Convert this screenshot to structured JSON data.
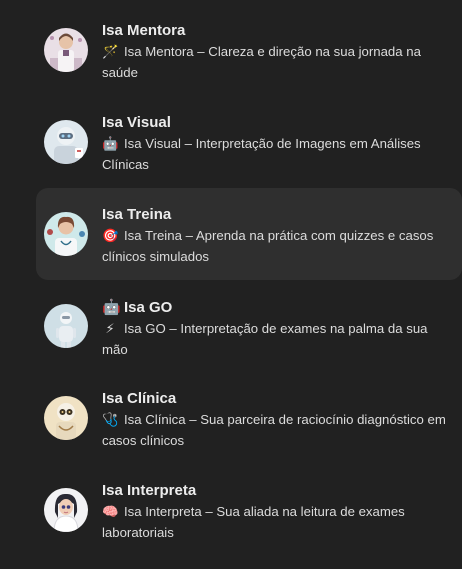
{
  "gpts": [
    {
      "name": "Isa Mentora",
      "emoji": "🪄",
      "description": "Isa Mentora – Clareza e direção na sua jornada na saúde",
      "avatar_icon": "mentora-doctor-avatar",
      "colors": {
        "bg": "#e9dfe6",
        "accent": "#7a5a7a"
      }
    },
    {
      "name": "Isa Visual",
      "emoji": "🤖",
      "description": "Isa Visual – Interpretação de Imagens em Análises Clínicas",
      "avatar_icon": "visual-robot-avatar",
      "colors": {
        "bg": "#dfe8ee",
        "accent": "#5c6e82"
      }
    },
    {
      "name": "Isa Treina",
      "emoji": "🎯",
      "description": "Isa Treina – Aprenda na prática com quizzes e casos clínicos simulados",
      "avatar_icon": "treina-doctor-avatar",
      "colors": {
        "bg": "#cfe9ea",
        "accent": "#b14a4a"
      }
    },
    {
      "name": "Isa GO",
      "name_emoji": "🤖",
      "emoji": "⚡",
      "description": "Isa GO – Interpretação de exames na palma da sua mão",
      "avatar_icon": "go-robot-avatar",
      "colors": {
        "bg": "#cfdfe6",
        "accent": "#8a97a5"
      }
    },
    {
      "name": "Isa Clínica",
      "emoji": "🩺",
      "description": "Isa Clínica – Sua parceira de raciocínio diagnóstico em casos clínicos",
      "avatar_icon": "clinica-robot-avatar",
      "colors": {
        "bg": "#f0e2c4",
        "accent": "#a27d4a"
      }
    },
    {
      "name": "Isa Interpreta",
      "emoji": "🧠",
      "description": "Isa Interpreta – Sua aliada na leitura de exames laboratoriais",
      "avatar_icon": "interpreta-avatar",
      "colors": {
        "bg": "#f2f2f4",
        "accent": "#2a2a34"
      }
    }
  ],
  "active_index": 2
}
